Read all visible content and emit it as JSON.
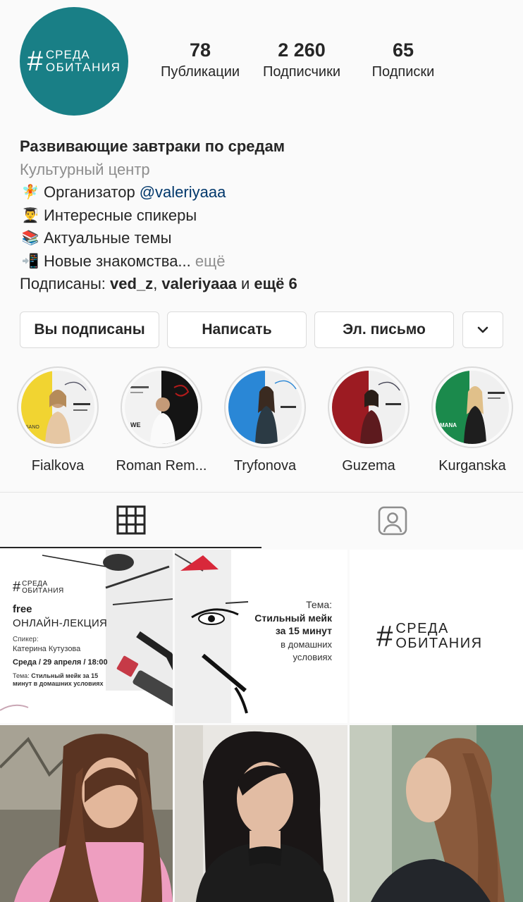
{
  "profile": {
    "avatar_logo": {
      "hash": "#",
      "line1": "СРЕДА",
      "line2": "ОБИТАНИЯ"
    },
    "stats": [
      {
        "value": "78",
        "label": "Публикации"
      },
      {
        "value": "2 260",
        "label": "Подписчики"
      },
      {
        "value": "65",
        "label": "Подписки"
      }
    ],
    "bio": {
      "name": "Развивающие завтраки по средам",
      "category": "Культурный центр",
      "lines": [
        {
          "emoji": "🧚",
          "text": "Организатор ",
          "mention": "@valeriyaaa"
        },
        {
          "emoji": "👨‍🎓",
          "text": "Интересные спикеры"
        },
        {
          "emoji": "📚",
          "text": "Актуальные темы"
        },
        {
          "emoji": "📲",
          "text": "Новые знакомства...",
          "more": " ещё"
        }
      ],
      "followed_by": {
        "prefix": "Подписаны: ",
        "user1": "ved_z",
        "sep": ", ",
        "user2": "valeriyaaa",
        "and": " и ",
        "others": "ещё 6"
      }
    },
    "buttons": {
      "following": "Вы подписаны",
      "message": "Написать",
      "email": "Эл. письмо",
      "dropdown_icon": "chevron-down-icon"
    }
  },
  "highlights": [
    {
      "label": "Fialkova",
      "colors": [
        "#f1d431",
        "#f0f0f0"
      ]
    },
    {
      "label": "Roman Rem...",
      "colors": [
        "#f2f2f2",
        "#141414"
      ]
    },
    {
      "label": "Tryfonova",
      "colors": [
        "#2a87d6",
        "#f0f0f0"
      ]
    },
    {
      "label": "Guzema",
      "colors": [
        "#9c1b22",
        "#f0f0f0"
      ]
    },
    {
      "label": "Kurganska",
      "colors": [
        "#1b8a4c",
        "#f0f0f0"
      ]
    }
  ],
  "tabs": [
    {
      "name": "grid",
      "icon": "grid-icon",
      "active": true
    },
    {
      "name": "tagged",
      "icon": "tagged-person-icon",
      "active": false
    }
  ],
  "posts": {
    "lecture": {
      "hash": "#",
      "logo1": "СРЕДА",
      "logo2": "ОБИТАНИЯ",
      "free": "free",
      "title": "ОНЛАЙН-ЛЕКЦИЯ",
      "speaker_label": "Спикер:",
      "speaker": "Катерина Кутузова",
      "date": "Среда / 29 апреля / 18:00",
      "topic_prefix": "Тема: ",
      "topic": "Стильный мейк за 15 минут в домашних условиях"
    },
    "topic_card": {
      "label": "Тема:",
      "title_line1": "Стильный мейк",
      "title_line2": "за 15 минут",
      "sub_line1": "в домашних",
      "sub_line2": "условиях"
    },
    "logo_card": {
      "hash": "#",
      "line1": "СРЕДА",
      "line2": "ОБИТАНИЯ"
    }
  },
  "colors": {
    "avatar_bg": "#197f86",
    "mention": "#00376b",
    "muted": "#8e8e8e",
    "border": "#dbdbdb"
  }
}
